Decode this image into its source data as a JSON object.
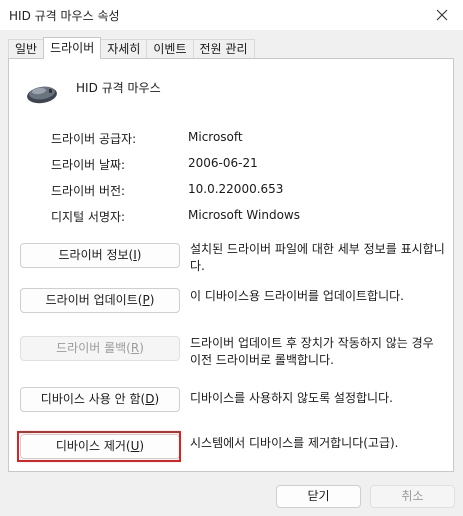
{
  "window": {
    "title": "HID 규격 마우스 속성"
  },
  "tabs": [
    {
      "label": "일반"
    },
    {
      "label": "드라이버",
      "active": true
    },
    {
      "label": "자세히"
    },
    {
      "label": "이벤트"
    },
    {
      "label": "전원 관리"
    }
  ],
  "device": {
    "name": "HID 규격 마우스",
    "icon": "mouse-icon"
  },
  "properties": [
    {
      "label": "드라이버 공급자:",
      "value": "Microsoft"
    },
    {
      "label": "드라이버 날짜:",
      "value": "2006-06-21"
    },
    {
      "label": "드라이버 버전:",
      "value": "10.0.22000.653"
    },
    {
      "label": "디지털 서명자:",
      "value": "Microsoft Windows"
    }
  ],
  "actions": [
    {
      "label_main": "드라이버 정보(",
      "accel": "I",
      "label_end": ")",
      "description": "설치된 드라이버 파일에 대한 세부 정보를 표시합니다.",
      "enabled": true
    },
    {
      "label_main": "드라이버 업데이트(",
      "accel": "P",
      "label_end": ")",
      "description": "이 디바이스용 드라이버를 업데이트합니다.",
      "enabled": true
    },
    {
      "label_main": "드라이버 롤백(",
      "accel": "R",
      "label_end": ")",
      "description": "드라이버 업데이트 후 장치가 작동하지 않는 경우 이전 드라이버로 롤백합니다.",
      "enabled": false
    },
    {
      "label_main": "디바이스 사용 안 함(",
      "accel": "D",
      "label_end": ")",
      "description": "디바이스를 사용하지 않도록 설정합니다.",
      "enabled": true
    },
    {
      "label_main": "디바이스 제거(",
      "accel": "U",
      "label_end": ")",
      "description": "시스템에서 디바이스를 제거합니다(고급).",
      "enabled": true
    }
  ],
  "footer": {
    "ok_label": "닫기",
    "cancel_label": "취소"
  },
  "colors": {
    "highlight": "#e02020"
  }
}
